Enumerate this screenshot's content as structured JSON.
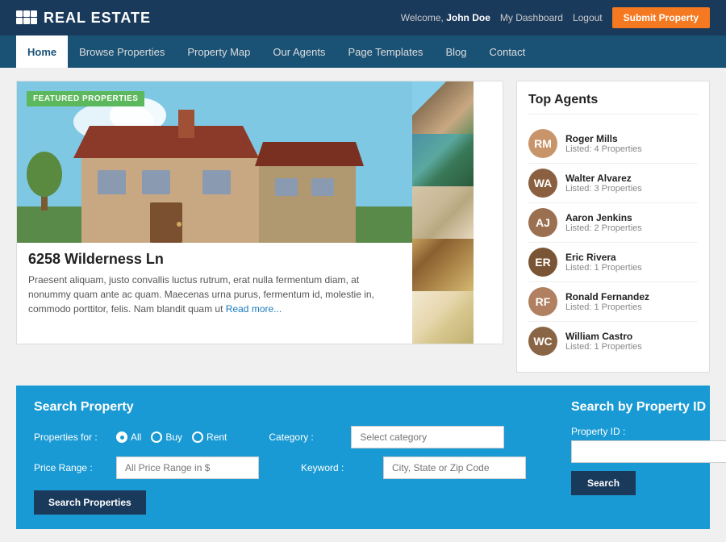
{
  "header": {
    "logo_text": "REAL ESTATE",
    "welcome_prefix": "Welcome,",
    "user_name": "John Doe",
    "dashboard_link": "My Dashboard",
    "logout_link": "Logout",
    "submit_btn": "Submit Property"
  },
  "nav": {
    "items": [
      {
        "label": "Home",
        "active": true
      },
      {
        "label": "Browse Properties",
        "active": false
      },
      {
        "label": "Property Map",
        "active": false
      },
      {
        "label": "Our Agents",
        "active": false
      },
      {
        "label": "Page Templates",
        "active": false
      },
      {
        "label": "Blog",
        "active": false
      },
      {
        "label": "Contact",
        "active": false
      }
    ]
  },
  "featured": {
    "badge": "Featured Properties",
    "property_title": "6258 Wilderness Ln",
    "property_desc": "Praesent aliquam, justo convallis luctus rutrum, erat nulla fermentum diam, at nonummy quam ante ac quam. Maecenas urna purus, fermentum id, molestie in, commodo porttitor, felis. Nam blandit quam ut",
    "read_more": "Read more..."
  },
  "agents": {
    "title": "Top Agents",
    "list": [
      {
        "name": "Roger Mills",
        "listed": "Listed: 4 Properties",
        "initials": "RM",
        "color": "#c8956a"
      },
      {
        "name": "Walter Alvarez",
        "listed": "Listed: 3 Properties",
        "initials": "WA",
        "color": "#8a6040"
      },
      {
        "name": "Aaron Jenkins",
        "listed": "Listed: 2 Properties",
        "initials": "AJ",
        "color": "#9a7050"
      },
      {
        "name": "Eric Rivera",
        "listed": "Listed: 1 Properties",
        "initials": "ER",
        "color": "#7a5535"
      },
      {
        "name": "Ronald Fernandez",
        "listed": "Listed: 1 Properties",
        "initials": "RF",
        "color": "#b08060"
      },
      {
        "name": "William Castro",
        "listed": "Listed: 1 Properties",
        "initials": "WC",
        "color": "#8a6545"
      }
    ]
  },
  "search": {
    "title": "Search Property",
    "properties_for_label": "Properties for :",
    "radio_options": [
      "All",
      "Buy",
      "Rent"
    ],
    "category_label": "Category :",
    "category_placeholder": "Select category",
    "price_label": "Price Range :",
    "price_placeholder": "All Price Range in $",
    "keyword_label": "Keyword :",
    "keyword_placeholder": "City, State or Zip Code",
    "search_btn": "Search Properties",
    "right_title": "Search by Property ID",
    "property_id_label": "Property ID :",
    "property_id_placeholder": "",
    "id_search_btn": "Search"
  }
}
